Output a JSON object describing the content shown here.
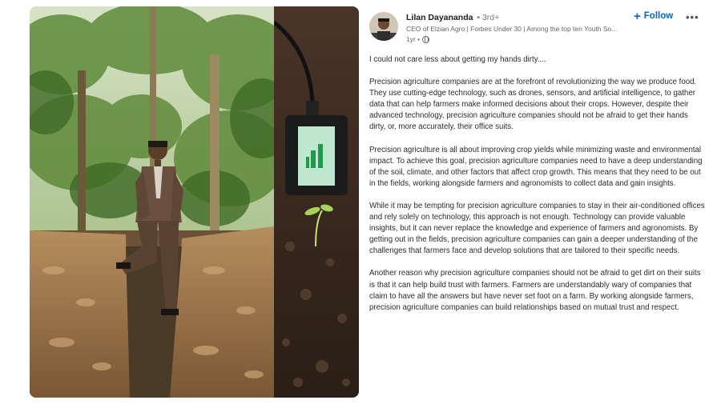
{
  "post": {
    "author": "Lilan Dayananda",
    "degree": "• 3rd+",
    "headline": "CEO of Elzian Agro | Forbes Under 30 | Among the top ten Youth So...",
    "time": "1yr •",
    "follow_label": "Follow",
    "more_label": "•••",
    "paragraphs": [
      "I could not care less about getting my hands dirty....",
      "Precision agriculture companies are at the forefront of revolutionizing the way we produce food. They use cutting-edge technology, such as drones, sensors, and artificial intelligence, to gather data that can help farmers make informed decisions about their crops. However, despite their advanced technology, precision agriculture companies should not be afraid to get their hands dirty, or, more accurately, their office suits.",
      "Precision agriculture is all about improving crop yields while minimizing waste and environmental impact. To achieve this goal, precision agriculture companies need to have a deep understanding of the soil, climate, and other factors that affect crop growth. This means that they need to be out in the fields, working alongside farmers and agronomists to collect data and gain insights.",
      "While it may be tempting for precision agriculture companies to stay in their air-conditioned offices and rely solely on technology, this approach is not enough. Technology can provide valuable insights, but it can never replace the knowledge and experience of farmers and agronomists. By getting out in the fields, precision agriculture companies can gain a deeper understanding of the challenges that farmers face and develop solutions that are tailored to their specific needs.",
      "Another reason why precision agriculture companies should not be afraid to get dirt on their suits is that it can help build trust with farmers. Farmers are understandably wary of companies that claim to have all the answers but have never set foot on a farm. By working alongside farmers, precision agriculture companies can build relationships based on mutual trust and respect."
    ]
  },
  "media": {
    "left_photo_icon": "man-in-suit-in-field-photo",
    "right_photo_icon": "soil-sensor-seedling-photo"
  },
  "colors": {
    "accent": "#0a66c2",
    "text": "#2b2b2b",
    "muted": "#666666"
  }
}
